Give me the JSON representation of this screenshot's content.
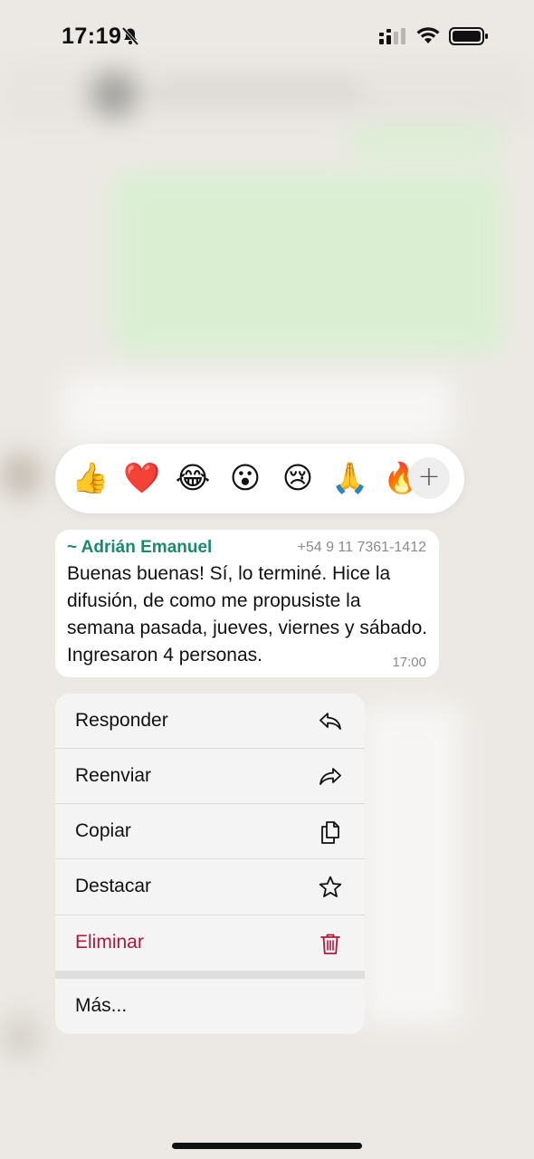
{
  "status_bar": {
    "time": "17:19"
  },
  "reactions": {
    "emojis": [
      "👍",
      "❤️",
      "😂",
      "😮",
      "😢",
      "🙏",
      "🔥"
    ],
    "more_label": "+"
  },
  "message": {
    "sender": "~ Adrián Emanuel",
    "phone": "+54 9 11 7361-1412",
    "text": "Buenas buenas! Sí, lo terminé. Hice la difusión, de como me propusiste la semana pasada, jueves, viernes y sábado. Ingresaron 4 personas.",
    "time": "17:00",
    "sender_color": "#1a8a6e"
  },
  "menu": {
    "items": [
      {
        "label": "Responder",
        "icon": "reply-icon"
      },
      {
        "label": "Reenviar",
        "icon": "forward-icon"
      },
      {
        "label": "Copiar",
        "icon": "copy-icon"
      },
      {
        "label": "Destacar",
        "icon": "star-icon"
      },
      {
        "label": "Eliminar",
        "icon": "trash-icon",
        "color": "#b0193a"
      }
    ],
    "more_label": "Más..."
  }
}
